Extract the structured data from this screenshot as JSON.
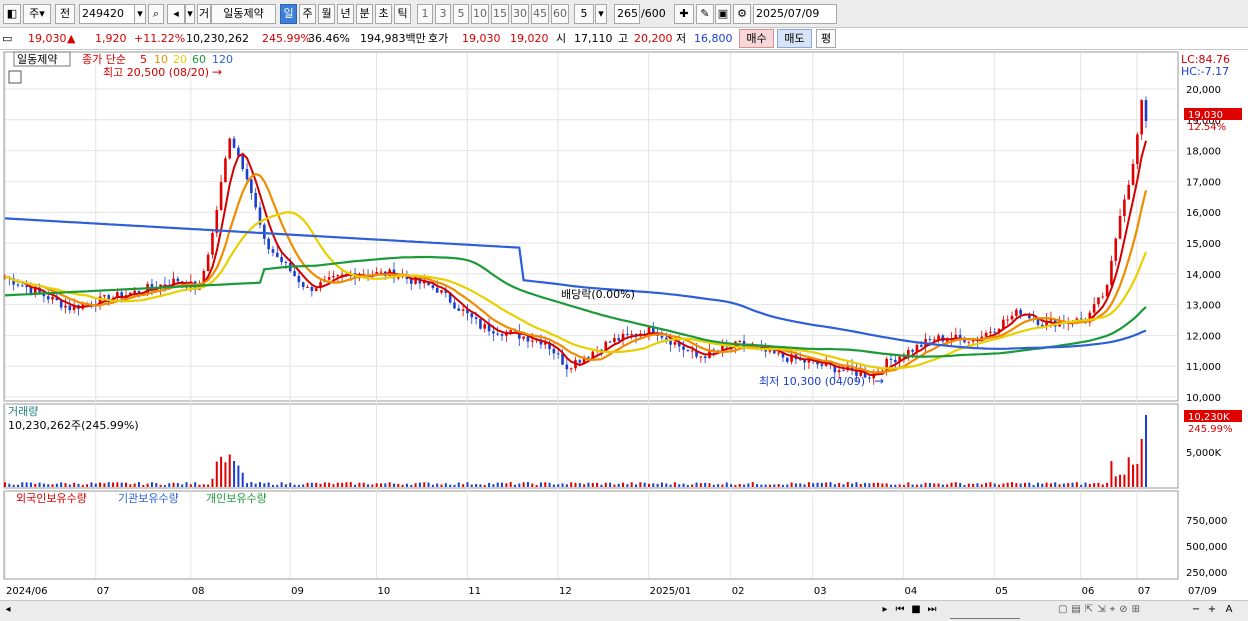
{
  "toolbar": {
    "market": "주",
    "prev": "전",
    "code": "249420",
    "category": "거",
    "name": "일동제약",
    "periods": [
      "일",
      "주",
      "월",
      "년",
      "분",
      "초",
      "틱"
    ],
    "active_period": "일",
    "intervals": [
      "1",
      "3",
      "5",
      "10",
      "15",
      "30",
      "45",
      "60"
    ],
    "count_value": "5",
    "range": "265",
    "range_total": "/600",
    "date": "2025/07/09"
  },
  "quote": {
    "price": "19,030",
    "change_arrow": "▲",
    "change": "1,920",
    "change_pct": "+11.22%",
    "volume": "10,230,262",
    "volume_ratio": "245.99%",
    "turnover": "36.46%",
    "amount": "194,983백만",
    "ask_label": "호가",
    "ask": "19,030",
    "bid": "19,020",
    "open_label": "시",
    "open": "17,110",
    "high_label": "고",
    "high": "20,200",
    "low_label": "저",
    "low": "16,800",
    "buy": "매수",
    "sell": "매도",
    "eval": "평"
  },
  "price_panel": {
    "stock_tag": "일동제약",
    "legend_prefix": "종가 단순",
    "ma_periods": [
      "5",
      "10",
      "20",
      "60",
      "120"
    ],
    "ma_colors": [
      "#d40000",
      "#f08c00",
      "#e8d000",
      "#1c9a3a",
      "#2c5fd8"
    ],
    "lc": "LC:84.76",
    "hc": "HC:-7.17",
    "high_annotation": "최고 20,500 (08/20)",
    "low_annotation": "최저 10,300 (04/09)",
    "dividend_annotation": "배당락(0.00%)",
    "current_price": "19,030",
    "current_pct": "12.54%",
    "y_ticks": [
      "20,000",
      "19,000",
      "18,000",
      "17,000",
      "16,000",
      "15,000",
      "14,000",
      "13,000",
      "12,000",
      "11,000",
      "10,000"
    ]
  },
  "volume_panel": {
    "title": "거래량",
    "value": "10,230,262주(245.99%)",
    "current": "10,230K",
    "current_pct": "245.99%",
    "tick": "5,000K"
  },
  "holdings_panel": {
    "series": [
      "외국인보유수량",
      "기관보유수량",
      "개인보유수량"
    ],
    "colors": [
      "#d40000",
      "#2c5fd8",
      "#1c9a3a"
    ],
    "ticks": [
      "750,000",
      "500,000",
      "250,000"
    ]
  },
  "x_axis": [
    "2024/06",
    "07",
    "08",
    "09",
    "10",
    "11",
    "12",
    "2025/01",
    "02",
    "03",
    "04",
    "05",
    "06",
    "07"
  ],
  "x_axis_end": "07/09",
  "chart_data": {
    "type": "line",
    "x": [
      "2024/06",
      "07",
      "08",
      "09",
      "10",
      "11",
      "12",
      "2025/01",
      "02",
      "03",
      "04",
      "05",
      "06",
      "07"
    ],
    "series": [
      {
        "name": "5",
        "values": [
          13800,
          13100,
          13500,
          14000,
          13900,
          13600,
          11200,
          11800,
          11500,
          11200,
          10900,
          11900,
          12600,
          16500
        ]
      },
      {
        "name": "120",
        "values": [
          15800,
          15200,
          14900,
          14700,
          14700,
          14400,
          13900,
          13400,
          12900,
          12300,
          11800,
          11600,
          11600,
          11900
        ]
      }
    ],
    "ylim": [
      10000,
      20500
    ]
  }
}
